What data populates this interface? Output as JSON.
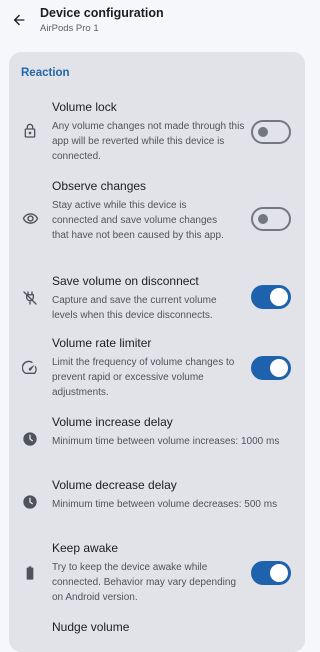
{
  "header": {
    "title": "Device configuration",
    "subtitle": "AirPods Pro 1",
    "back_icon": "arrow-back-icon"
  },
  "section": {
    "title": "Reaction",
    "items": [
      {
        "title": "Volume lock",
        "description": "Any volume changes not made through this app will be reverted while this device is connected.",
        "icon": "lock-icon",
        "toggle": false
      },
      {
        "title": "Observe changes",
        "description": "Stay active while this device is connected and save volume changes that have not been caused by this app.",
        "icon": "eye-icon",
        "toggle": false
      },
      {
        "title": "Save volume on disconnect",
        "description": "Capture and save the current volume levels when this device disconnects.",
        "icon": "power-off-icon",
        "toggle": true
      },
      {
        "title": "Volume rate limiter",
        "description": "Limit the frequency of volume changes to prevent rapid or excessive volume adjustments.",
        "icon": "speedometer-icon",
        "toggle": true
      },
      {
        "title": "Volume increase delay",
        "description": "Minimum time between volume increases: 1000 ms",
        "icon": "clock-icon"
      },
      {
        "title": "Volume decrease delay",
        "description": "Minimum time between volume decreases: 500 ms",
        "icon": "clock-icon"
      },
      {
        "title": "Keep awake",
        "description": "Try to keep the device awake while connected. Behavior may vary depending on Android version.",
        "icon": "battery-icon",
        "toggle": true
      },
      {
        "title": "Nudge volume"
      }
    ]
  },
  "colors": {
    "accent": "#1e62ad",
    "section_title": "#2467a8",
    "card_bg": "#e1e3e8",
    "page_bg": "#f6f7fb"
  }
}
